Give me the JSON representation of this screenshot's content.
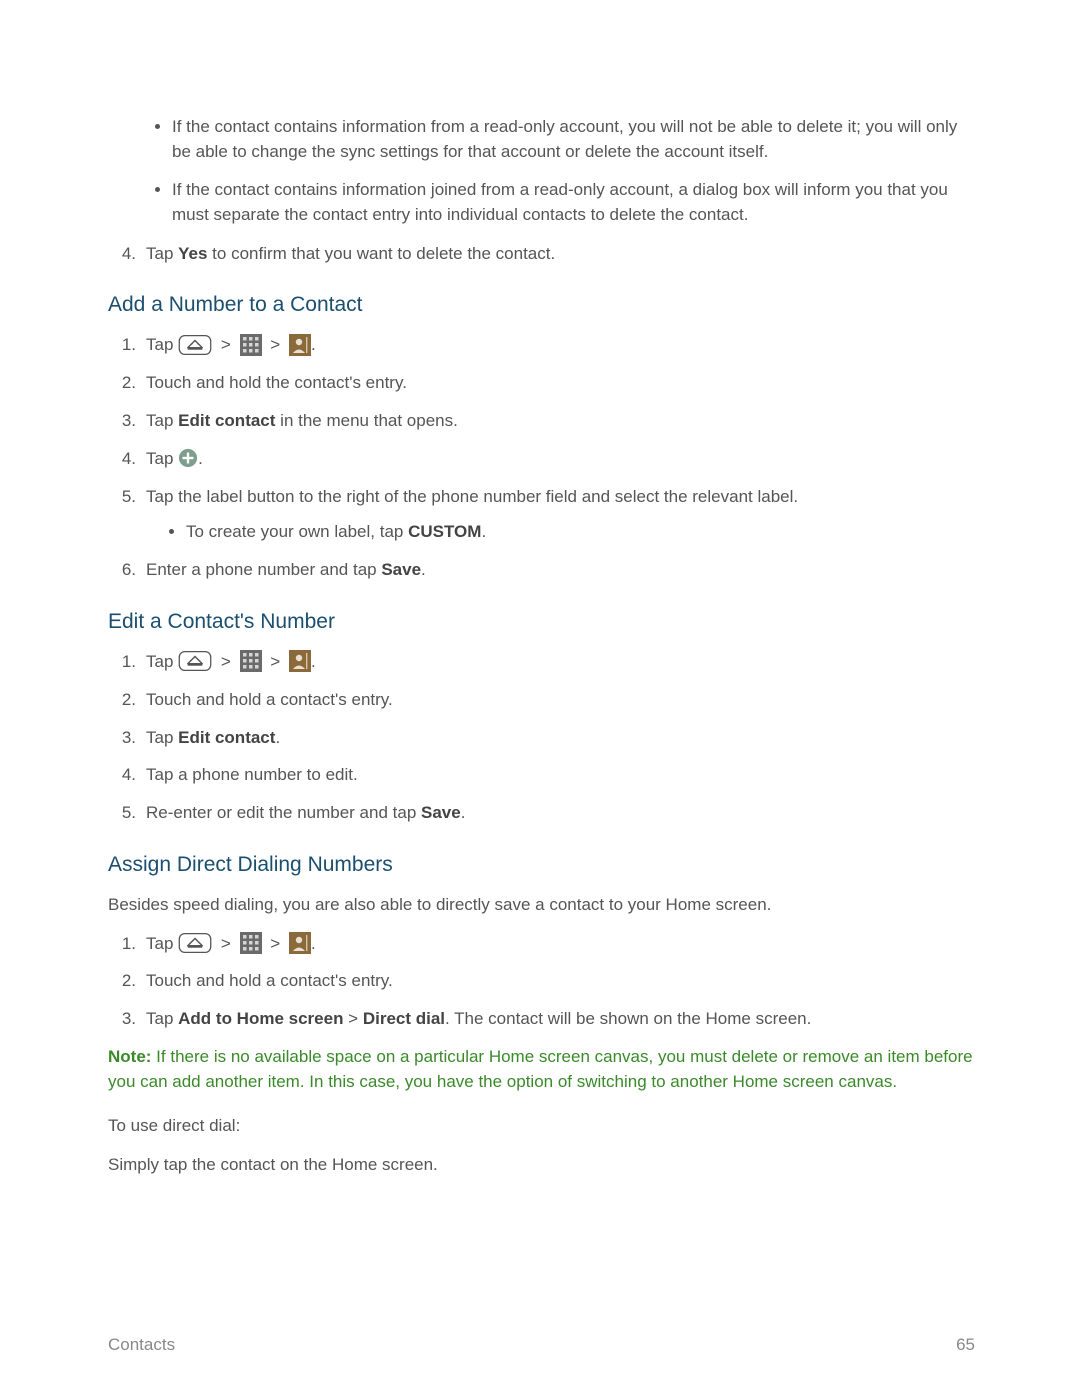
{
  "delete": {
    "bullets": [
      "If the contact contains information from a read-only account, you will not be able to delete it; you will only be able to change the sync settings for that account or delete the account itself.",
      "If the contact contains information joined from a read-only account, a dialog box will inform you that you must separate the contact entry into individual contacts to delete the contact."
    ],
    "step4_num": "4.",
    "step4_pre": "Tap ",
    "step4_bold": "Yes",
    "step4_post": " to confirm that you want to delete the contact."
  },
  "add": {
    "heading": "Add a Number to a Contact",
    "s1num": "1.",
    "s1tap": "Tap",
    "gt": ">",
    "period": ".",
    "s2num": "2.",
    "s2text": "Touch and hold the contact's entry.",
    "s3num": "3.",
    "s3pre": "Tap ",
    "s3bold": "Edit contact",
    "s3post": " in the menu that opens.",
    "s4num": "4.",
    "s4tap": "Tap",
    "s5num": "5.",
    "s5text": "Tap the label button to the right of the phone number field and select the relevant label.",
    "s5sub_pre": "To create your own label, tap ",
    "s5sub_bold": "CUSTOM",
    "s6num": "6.",
    "s6pre": "Enter a phone number and tap ",
    "s6bold": "Save"
  },
  "edit": {
    "heading": "Edit a Contact's Number",
    "s1num": "1.",
    "s1tap": "Tap",
    "gt": ">",
    "period": ".",
    "s2num": "2.",
    "s2text": "Touch and hold a contact's entry.",
    "s3num": "3.",
    "s3pre": "Tap ",
    "s3bold": "Edit contact",
    "s3post": ".",
    "s4num": "4.",
    "s4text": "Tap a phone number to edit.",
    "s5num": "5.",
    "s5pre": "Re-enter or edit the number and tap ",
    "s5bold": "Save",
    "s5post": "."
  },
  "assign": {
    "heading": "Assign Direct Dialing Numbers",
    "intro": "Besides speed dialing, you are also able to directly save a contact to your Home screen.",
    "s1num": "1.",
    "s1tap": "Tap",
    "gt": ">",
    "period": ".",
    "s2num": "2.",
    "s2text": "Touch and hold a contact's entry.",
    "s3num": "3.",
    "s3pre": "Tap ",
    "s3bold1": "Add to Home screen",
    "s3mid": " > ",
    "s3bold2": "Direct dial",
    "s3post": ". The contact will be shown on the Home screen.",
    "note_label": "Note:",
    "note_text": "  If there is no available space on a particular Home screen canvas, you must delete or remove an item before you can add another item. In this case, you have the option of switching to another Home screen canvas.",
    "use": "To use direct dial:",
    "simply": "Simply tap the contact on the Home screen."
  },
  "footer": {
    "left": "Contacts",
    "right": "65"
  }
}
